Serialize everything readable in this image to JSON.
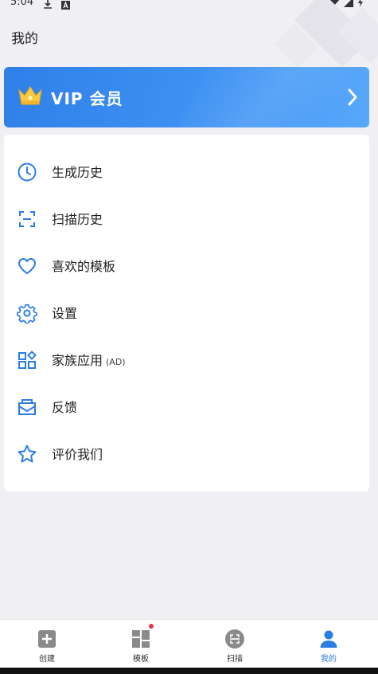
{
  "status_bar": {
    "time": "5:04"
  },
  "header": {
    "title": "我的"
  },
  "vip": {
    "label": "VIP 会员"
  },
  "menu": [
    {
      "label": "生成历史",
      "suffix": "",
      "icon": "clock-icon"
    },
    {
      "label": "扫描历史",
      "suffix": "",
      "icon": "scan-frame-icon"
    },
    {
      "label": "喜欢的模板",
      "suffix": "",
      "icon": "heart-icon"
    },
    {
      "label": "设置",
      "suffix": "",
      "icon": "gear-icon"
    },
    {
      "label": "家族应用",
      "suffix": "(AD)",
      "icon": "apps-grid-icon"
    },
    {
      "label": "反馈",
      "suffix": "",
      "icon": "mail-icon"
    },
    {
      "label": "评价我们",
      "suffix": "",
      "icon": "star-icon"
    }
  ],
  "bottom_nav": [
    {
      "label": "创建",
      "icon": "plus-square-icon",
      "active": false
    },
    {
      "label": "模板",
      "icon": "template-grid-icon",
      "active": false,
      "badge": true
    },
    {
      "label": "扫描",
      "icon": "scan-icon",
      "active": false
    },
    {
      "label": "我的",
      "icon": "person-icon",
      "active": true
    }
  ],
  "colors": {
    "accent": "#2a7de1",
    "vip_gradient_start": "#2f7fe8",
    "vip_gradient_end": "#58a8fb",
    "icon": "#2a7de1",
    "badge": "#e8314a",
    "background": "#efeff4"
  }
}
